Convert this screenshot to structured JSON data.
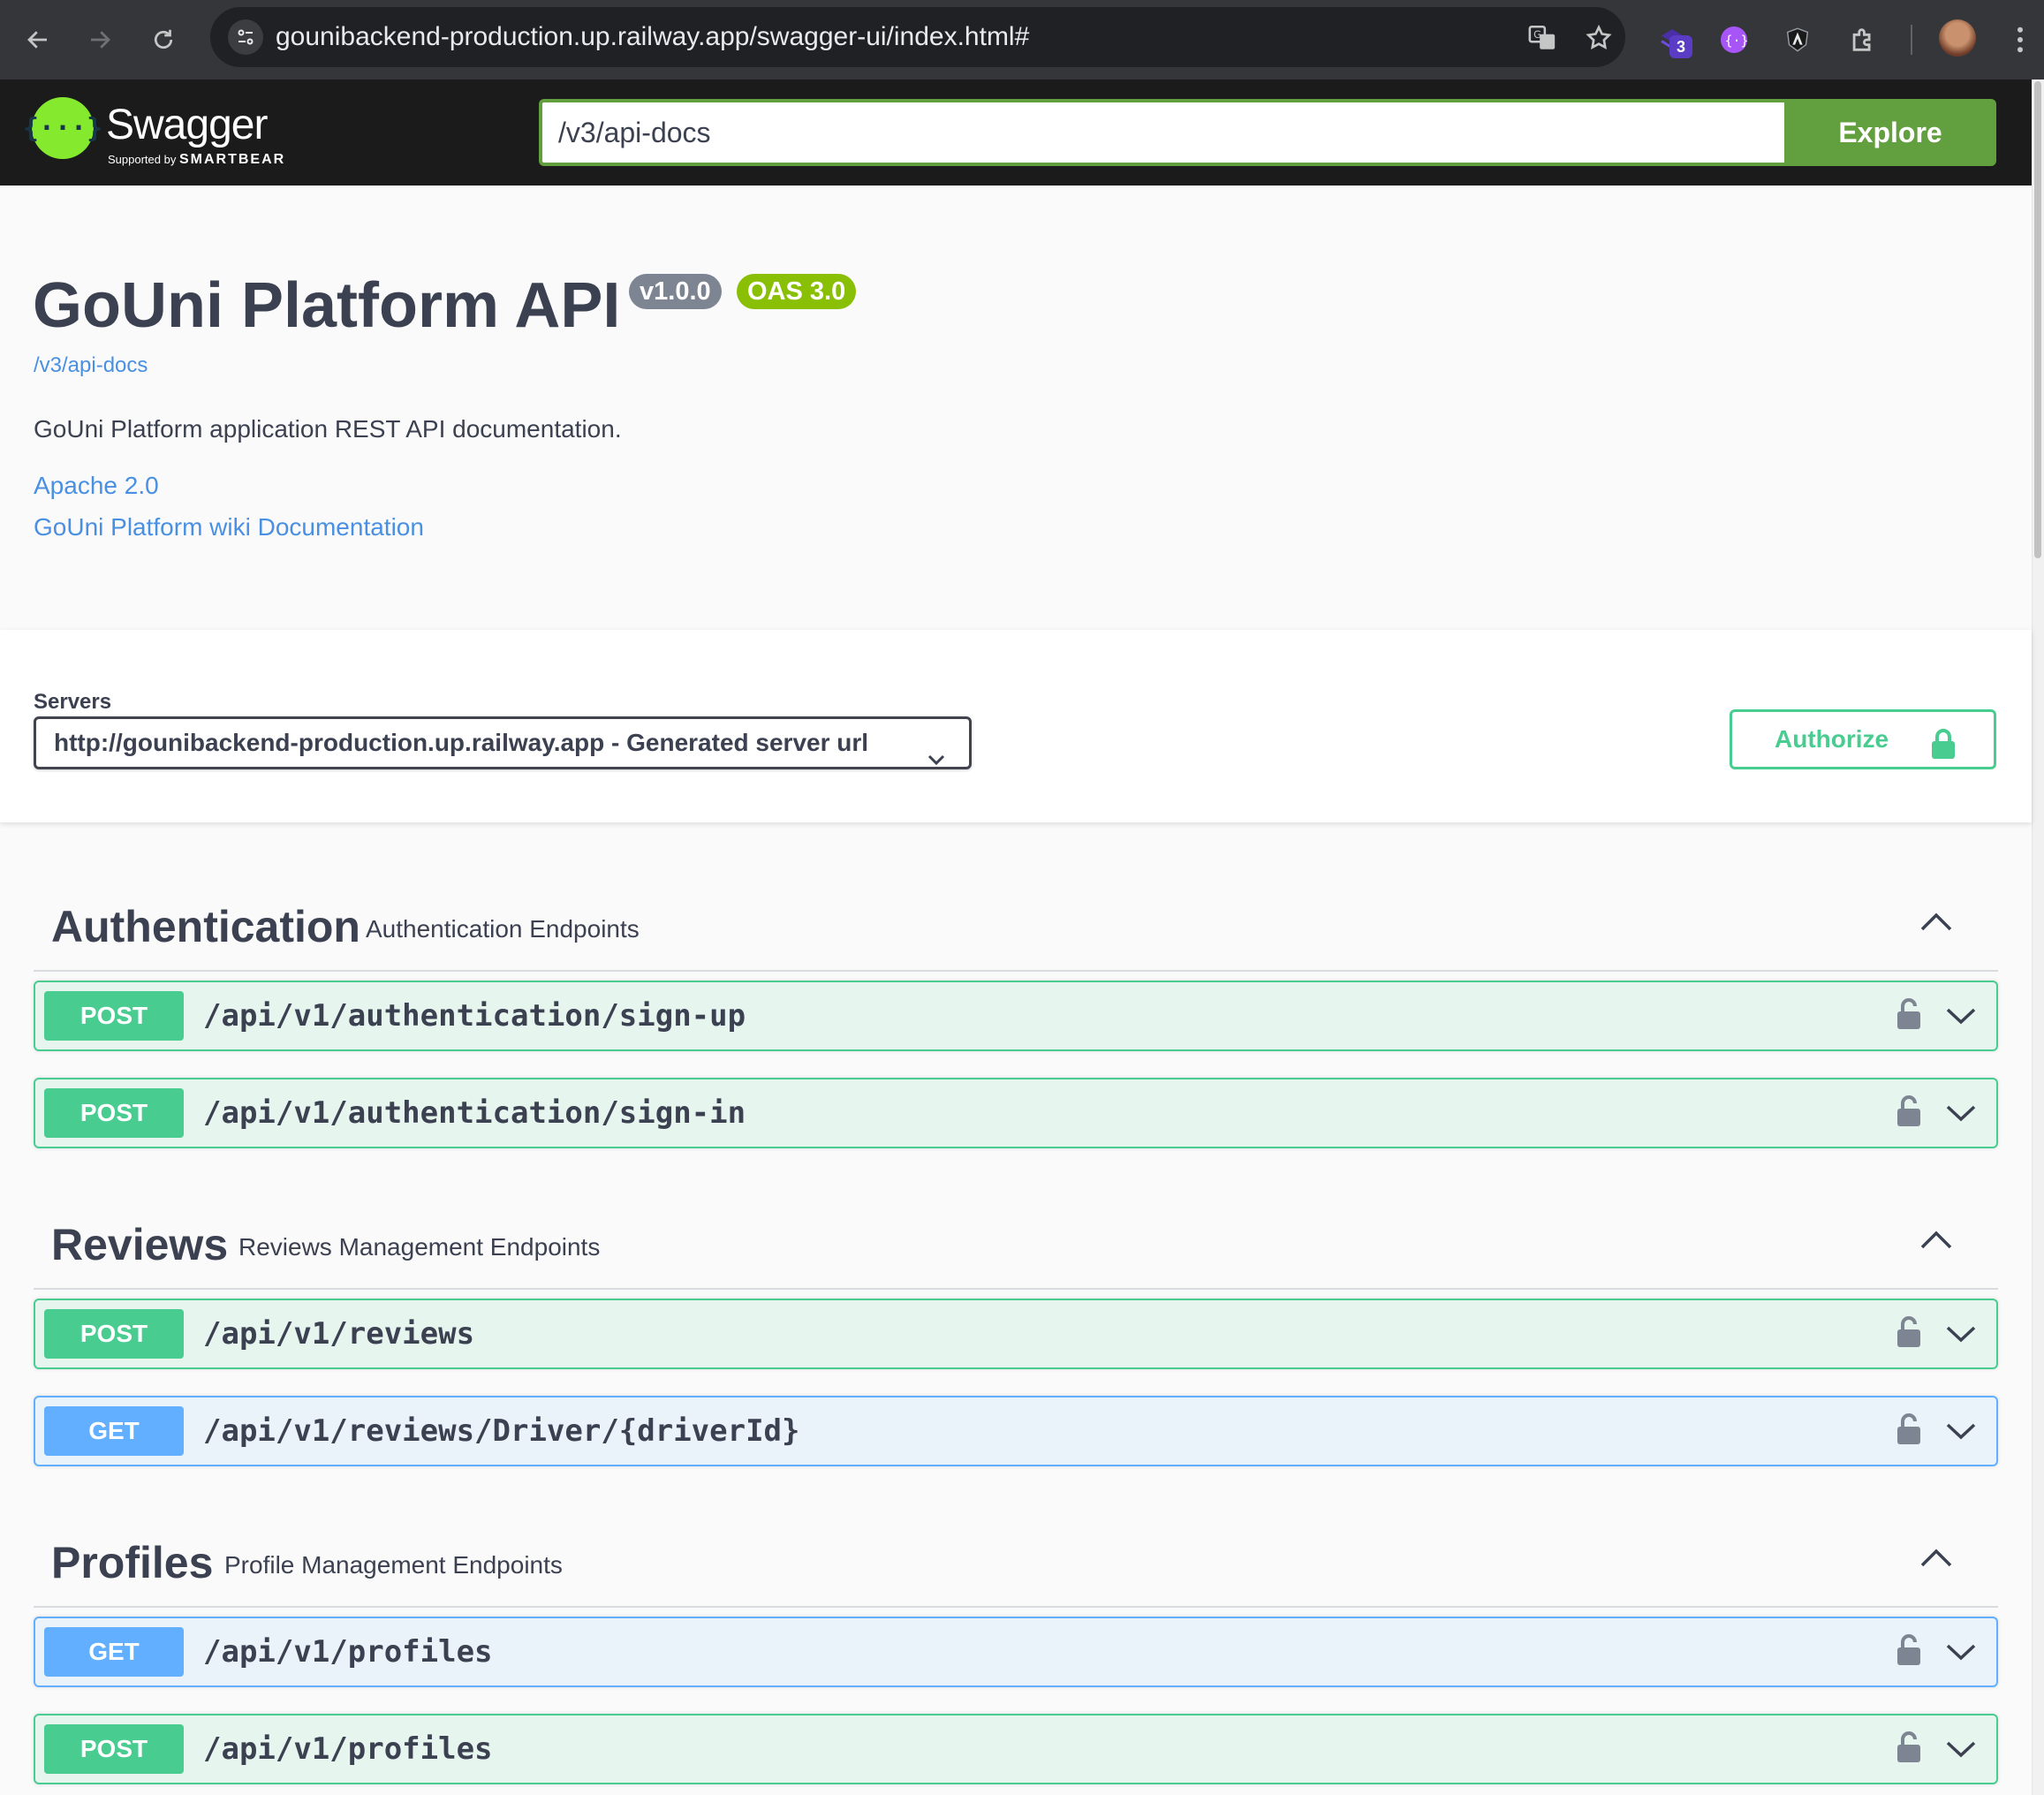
{
  "browser": {
    "url": "gounibackend-production.up.railway.app/swagger-ui/index.html#",
    "extension_badge": "3",
    "icons": [
      "back-icon",
      "forward-icon",
      "reload-icon",
      "tune-icon",
      "translate-icon",
      "bookmark-star-icon",
      "extension-icon",
      "extension-icon",
      "extension-icon",
      "extensions-puzzle-icon",
      "profile-avatar",
      "more-menu-icon"
    ]
  },
  "topbar": {
    "logo_name": "Swagger",
    "logo_supported": "Supported by",
    "logo_smartbear": "SMARTBEAR",
    "spec_url_value": "/v3/api-docs",
    "explore_label": "Explore"
  },
  "info": {
    "title": "GoUni Platform API",
    "version": "v1.0.0",
    "oas": "OAS 3.0",
    "spec_link": "/v3/api-docs",
    "description": "GoUni Platform application REST API documentation.",
    "license_link": "Apache 2.0",
    "docs_link": "GoUni Platform wiki Documentation"
  },
  "servers": {
    "label": "Servers",
    "selected": "http://gounibackend-production.up.railway.app - Generated server url",
    "authorize_label": "Authorize"
  },
  "tags": [
    {
      "name": "Authentication",
      "description": "Authentication Endpoints",
      "operations": [
        {
          "method": "POST",
          "path": "/api/v1/authentication/sign-up"
        },
        {
          "method": "POST",
          "path": "/api/v1/authentication/sign-in"
        }
      ]
    },
    {
      "name": "Reviews",
      "description": "Reviews Management Endpoints",
      "operations": [
        {
          "method": "POST",
          "path": "/api/v1/reviews"
        },
        {
          "method": "GET",
          "path": "/api/v1/reviews/Driver/{driverId}"
        }
      ]
    },
    {
      "name": "Profiles",
      "description": "Profile Management Endpoints",
      "operations": [
        {
          "method": "GET",
          "path": "/api/v1/profiles"
        },
        {
          "method": "POST",
          "path": "/api/v1/profiles"
        }
      ]
    }
  ],
  "colors": {
    "post": "#49cc90",
    "get": "#61affe",
    "brand_green": "#85ea2d",
    "link_blue": "#4990e2"
  }
}
